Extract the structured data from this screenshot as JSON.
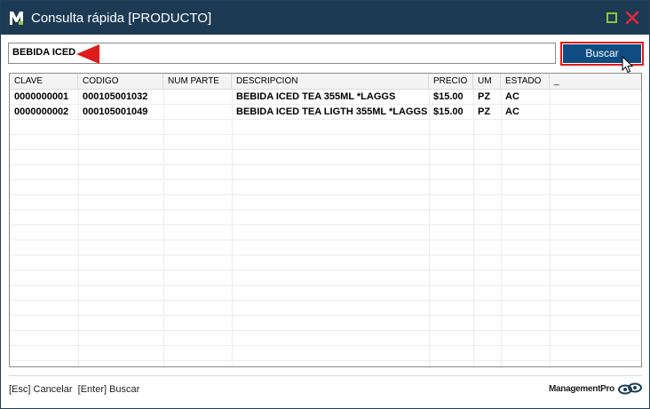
{
  "window": {
    "title": "Consulta rápida [PRODUCTO]"
  },
  "search": {
    "value": "BEBIDA ICED",
    "button_label": "Buscar"
  },
  "table": {
    "columns": [
      "CLAVE",
      "CODIGO",
      "NUM PARTE",
      "DESCRIPCION",
      "PRECIO",
      "UM",
      "ESTADO",
      "_"
    ],
    "rows": [
      {
        "clave": "0000000001",
        "codigo": "000105001032",
        "num_parte": "",
        "descripcion": "BEBIDA ICED TEA 355ML *LAGGS",
        "precio": "$15.00",
        "um": "PZ",
        "estado": "AC"
      },
      {
        "clave": "0000000002",
        "codigo": "000105001049",
        "num_parte": "",
        "descripcion": "BEBIDA ICED TEA LIGTH 355ML *LAGGS",
        "precio": "$15.00",
        "um": "PZ",
        "estado": "AC"
      }
    ]
  },
  "footer": {
    "hint": "[Esc] Cancelar  [Enter] Buscar",
    "brand": "ManagementPro"
  },
  "icons": {
    "app": "management-pro-logo-icon",
    "maximize": "maximize-icon",
    "close": "close-icon",
    "pointer": "red-arrow-pointer-icon",
    "cursor": "mouse-cursor-icon"
  },
  "colors": {
    "titlebar": "#1c3a54",
    "button": "#0f4c81",
    "highlight": "#e01b1b",
    "maximize": "#8dc63f",
    "close": "#e0293a"
  }
}
